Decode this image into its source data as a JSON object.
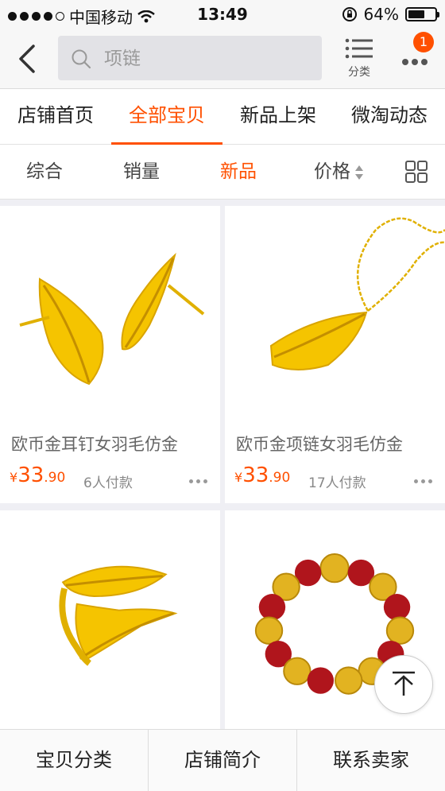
{
  "status_bar": {
    "carrier": "中国移动",
    "time": "13:49",
    "battery": "64%",
    "battery_level": 0.64
  },
  "nav": {
    "search_placeholder": "项链",
    "category_label": "分类",
    "badge_count": "1"
  },
  "tabs": [
    {
      "label": "店铺首页",
      "active": false
    },
    {
      "label": "全部宝贝",
      "active": true
    },
    {
      "label": "新品上架",
      "active": false
    },
    {
      "label": "微淘动态",
      "active": false
    }
  ],
  "sort": {
    "overall": "综合",
    "sales": "销量",
    "new": "新品",
    "price": "价格"
  },
  "products": [
    {
      "title": "欧币金耳钉女羽毛仿金",
      "currency": "¥",
      "price_int": "33",
      "price_dec": ".90",
      "sold": "6人付款"
    },
    {
      "title": "欧币金项链女羽毛仿金",
      "currency": "¥",
      "price_int": "33",
      "price_dec": ".90",
      "sold": "17人付款"
    },
    {
      "title": "",
      "currency": "",
      "price_int": "",
      "price_dec": "",
      "sold": ""
    },
    {
      "title": "",
      "currency": "",
      "price_int": "",
      "price_dec": "",
      "sold": ""
    }
  ],
  "bottom_bar": {
    "categories": "宝贝分类",
    "shop_intro": "店铺简介",
    "contact": "联系卖家"
  },
  "colors": {
    "accent": "#ff5000",
    "gold": "#f5c400",
    "red_bead": "#b0151c"
  },
  "icons": [
    "back-icon",
    "search-icon",
    "list-icon",
    "more-icon",
    "grid-icon",
    "back-to-top-icon",
    "sort-arrows-icon"
  ]
}
